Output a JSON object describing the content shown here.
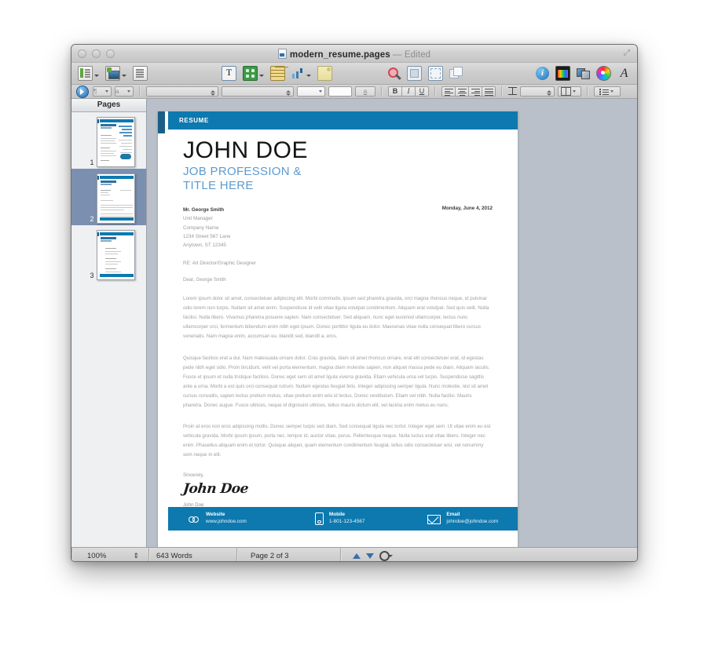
{
  "window": {
    "title": "modern_resume.pages",
    "title_suffix": "— Edited",
    "traffic_lights": [
      "close",
      "minimize",
      "zoom"
    ],
    "fullscreen_glyph": "⤢"
  },
  "toolbar": {
    "items": [
      {
        "name": "view-button",
        "label": "View",
        "icon": "document-icon",
        "has_menu": true
      },
      {
        "name": "media-button",
        "label": "Media",
        "icon": "media-icon",
        "has_menu": true
      },
      {
        "name": "sections-button",
        "label": "Sections",
        "icon": "list-icon",
        "has_menu": false
      },
      {
        "name": "text-box-button",
        "label": "Text Box",
        "icon": "text-box-icon",
        "has_menu": false
      },
      {
        "name": "shapes-button",
        "label": "Shapes",
        "icon": "shapes-icon",
        "has_menu": true
      },
      {
        "name": "table-button",
        "label": "Table",
        "icon": "table-icon",
        "has_menu": false
      },
      {
        "name": "charts-button",
        "label": "Charts",
        "icon": "bar-chart-icon",
        "has_menu": true
      },
      {
        "name": "comment-button",
        "label": "Comment",
        "icon": "sticky-note-icon",
        "has_menu": false
      },
      {
        "name": "inspector-button",
        "label": "Inspector",
        "icon": "magnifier-icon",
        "has_menu": false
      },
      {
        "name": "mask-button",
        "label": "Mask",
        "icon": "mask-frame-icon",
        "has_menu": false
      },
      {
        "name": "instant-alpha-button",
        "label": "Instant Alpha",
        "icon": "alpha-frame-icon",
        "has_menu": false
      },
      {
        "name": "group-button",
        "label": "Group",
        "icon": "group-shapes-icon",
        "has_menu": false
      },
      {
        "name": "info-button",
        "label": "Inspector Info",
        "icon": "info-icon",
        "has_menu": false
      },
      {
        "name": "media-browser-button",
        "label": "Media Browser",
        "icon": "media-browser-icon",
        "has_menu": false
      },
      {
        "name": "share-button",
        "label": "Share",
        "icon": "share-media-icon",
        "has_menu": false
      },
      {
        "name": "colors-button",
        "label": "Colors",
        "icon": "color-wheel-icon",
        "has_menu": false
      },
      {
        "name": "fonts-button",
        "label": "Fonts",
        "icon": "font-a-icon",
        "has_menu": false
      }
    ]
  },
  "format_bar": {
    "paragraph_style_label": "¶",
    "character_style_label": "a",
    "font_family_value": "",
    "font_size_value": "",
    "text_color_value": "",
    "fill_color_value": "",
    "underline_label": "a",
    "bold_label": "B",
    "italic_label": "I",
    "underline_btn_label": "U",
    "align_left": "align-left",
    "align_center": "align-center",
    "align_right": "align-right",
    "align_justify": "align-justify",
    "line_spacing_value": "",
    "columns_value": "",
    "bullets_value": ""
  },
  "sidebar": {
    "header": "Pages",
    "thumbnails": [
      {
        "number": "1",
        "selected": false,
        "kind": "resume"
      },
      {
        "number": "2",
        "selected": true,
        "kind": "letter"
      },
      {
        "number": "3",
        "selected": false,
        "kind": "references"
      }
    ]
  },
  "document": {
    "band_label": "RESUME",
    "name": "JOHN DOE",
    "title_line1": "JOB PROFESSION &",
    "title_line2": "TITLE HERE",
    "recipient": {
      "name": "Mr. George Smith",
      "lines": [
        "Unit Manager",
        "Company Name",
        "1234 Street 567 Lane",
        "Anytown, ST 12345"
      ]
    },
    "date": "Monday, June 4, 2012",
    "re_line": "RE: Art Director/Graphic Designer",
    "salutation": "Dear, George Smith",
    "paragraphs": [
      "Lorem ipsum dolor sit amet, consectetuer adipiscing elit. Morbi commodo, ipsum sed pharetra gravida, orci magna rhoncus neque, id pulvinar odio lorem non turpis. Nullam sit amet enim. Suspendisse id velit vitae ligula volutpat condimentum. Aliquam erat volutpat. Sed quis velit. Nulla facilisi. Nulla libero. Vivamus pharetra posuere sapien. Nam consectetuer. Sed aliquam, nunc eget euismod ullamcorper, lectus nunc ullamcorper orci, fermentum bibendum enim nibh eget ipsum. Donec porttitor ligula eu dolor. Maecenas vitae nulla consequat libero cursus venenatis. Nam magna enim, accumsan eu, blandit sed, blandit a, eros.",
      "Quisque facilisis erat a dui. Nam malesuada ornare dolor. Cras gravida, diam sit amet rhoncus ornare, erat elit consectetuer erat, id egestas pede nibh eget odio. Proin tincidunt, velit vel porta elementum, magna diam molestie sapien, non aliquet massa pede eu diam. Aliquam iaculis. Fusce et ipsum et nulla tristique facilisis. Donec eget sem sit amet ligula viverra gravida. Etiam vehicula urna vel turpis. Suspendisse sagittis ante a urna. Morbi a est quis orci consequat rutrum. Nullam egestas feugiat felis. Integer adipiscing semper ligula. Nunc molestie, nisl sit amet cursus convallis, sapien lectus pretium metus, vitae pretium enim wisi id lectus. Donec vestibulum. Etiam vel nibh. Nulla facilisi. Mauris pharetra. Donec augue. Fusce ultrices, neque id dignissim ultrices, tellus mauris dictum elit, vel lacinia enim metus eu nunc.",
      "Proin at eros non eros adipiscing mollis. Donec semper turpis sed diam. Sed consequat ligula nec tortor. Integer eget sem. Ut vitae enim eu est vehicula gravida. Morbi ipsum ipsum, porta nec, tempor id, auctor vitae, purus. Pellentesque neque. Nulla luctus erat vitae libero. Integer nec enim. Phasellus aliquam enim et tortor. Quisque aliquet, quam elementum condimentum feugiat, tellus odio consectetuer wisi, vel nonummy sem neque in elit."
    ],
    "closing": "Sincerely,",
    "signature": "John Doe",
    "signer_name": "John Doe",
    "footer": [
      {
        "icon": "link-icon",
        "label": "Website",
        "value": "www.johndoe.com"
      },
      {
        "icon": "mobile-phone-icon",
        "label": "Mobile",
        "value": "1-801-123-4567"
      },
      {
        "icon": "envelope-icon",
        "label": "Email",
        "value": "johndoe@johndoe.com"
      }
    ]
  },
  "status_bar": {
    "zoom": "100%",
    "word_count": "643 Words",
    "page_indicator": "Page 2 of 3",
    "nav_prev": "previous-page",
    "nav_next": "next-page",
    "settings": "view-options"
  },
  "colors": {
    "accent_teal": "#0d79af",
    "accent_dark_blue": "#1c5f86",
    "title_blue": "#5b9bd0",
    "canvas_gray": "#b9c0c9",
    "selection_blue": "#7b8fb0"
  }
}
